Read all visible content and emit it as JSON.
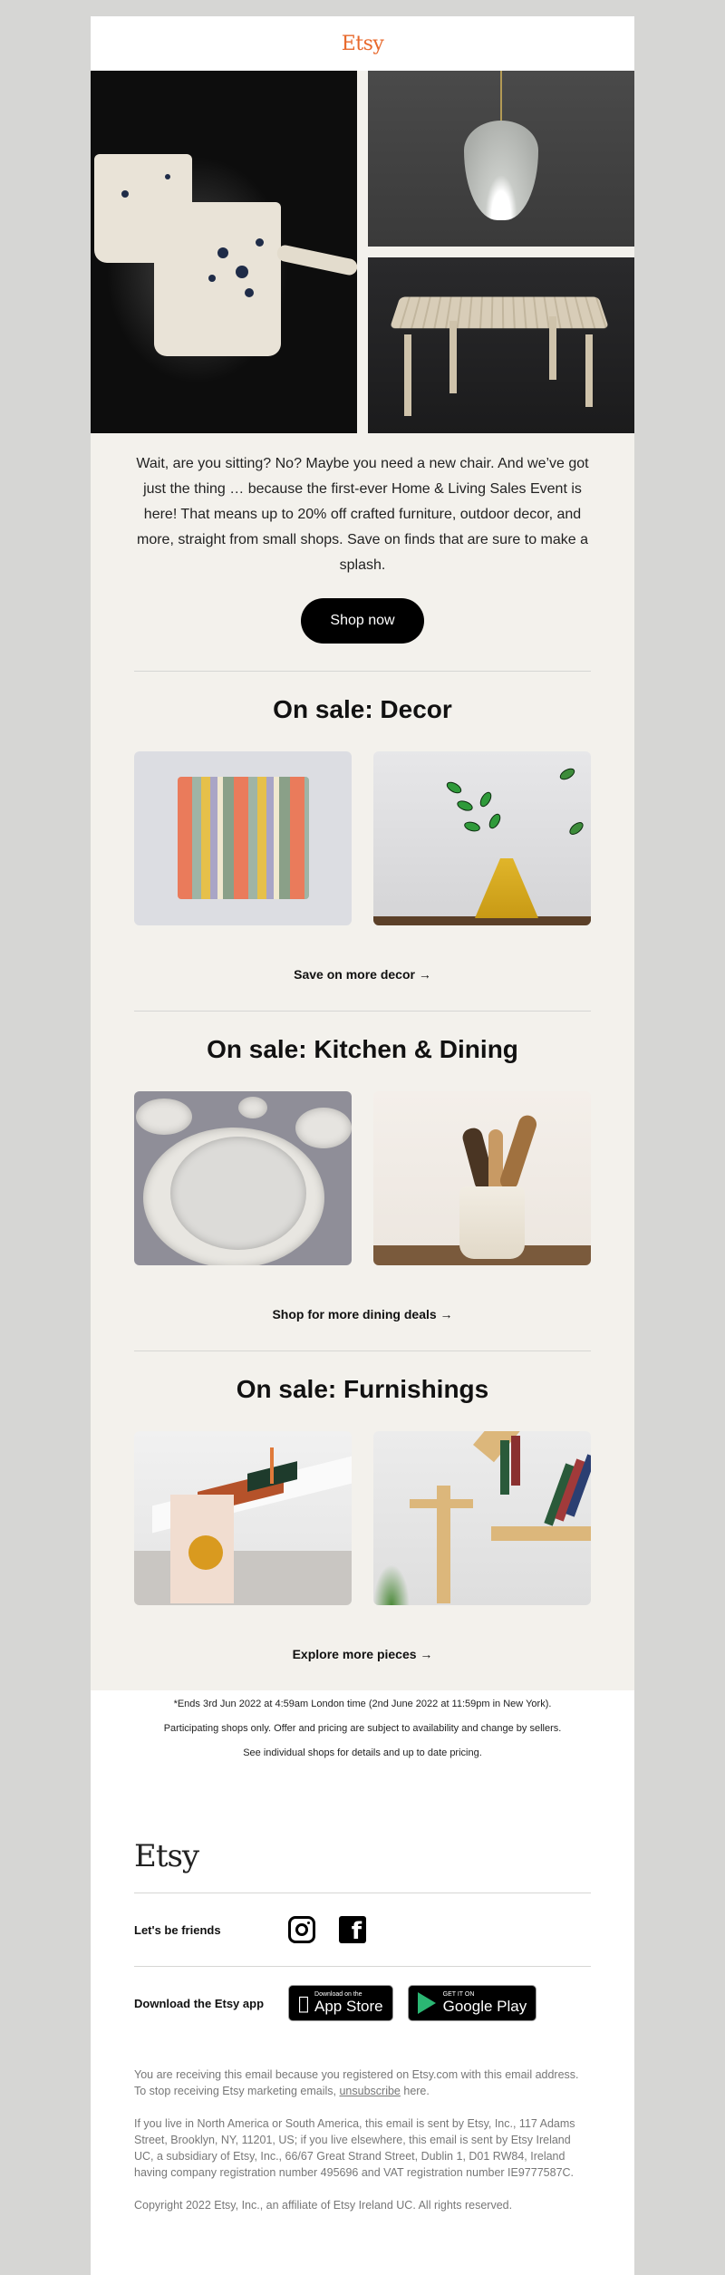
{
  "header": {
    "logo": "Etsy",
    "logo_color": "#e8692c"
  },
  "hero": {
    "images": [
      {
        "name": "speckled-ceramic-mugs"
      },
      {
        "name": "pendant-lamp"
      },
      {
        "name": "wooden-bench"
      }
    ]
  },
  "intro": {
    "text": "Wait, are you sitting? No? Maybe you need a new chair. And we’ve got just the thing … because the first-ever Home & Living Sales Event is here! That means up to 20% off crafted furniture, outdoor decor, and more, straight from small shops. Save on finds that are sure to make a splash.",
    "cta_label": "Shop now"
  },
  "sections": [
    {
      "title": "On sale: Decor",
      "images": [
        "striped woven pillow",
        "stained glass leaf in yellow vase"
      ],
      "link": "Save on more decor →"
    },
    {
      "title": "On sale: Kitchen & Dining",
      "images": [
        "ruffled ceramic plates",
        "wooden utensils in ceramic crock"
      ],
      "link": "Shop for more dining deals →"
    },
    {
      "title": "On sale: Furnishings",
      "images": [
        "quilted table runner",
        "wooden wall bookshelf"
      ],
      "link": "Explore more pieces →"
    }
  ],
  "fine_print": [
    "*Ends 3rd Jun 2022 at 4:59am London time (2nd June 2022 at 11:59pm in New York).",
    "Participating shops only. Offer and pricing are subject to availability and change by sellers.",
    "See individual shops for details and up to date pricing."
  ],
  "footer": {
    "logo": "Etsy",
    "social_label": "Let's be friends",
    "social_icons": [
      "instagram-icon",
      "facebook-icon"
    ],
    "app_label": "Download the Etsy app",
    "app_store": {
      "small": "Download on the",
      "big": "App Store"
    },
    "google_play": {
      "small": "GET IT ON",
      "big": "Google Play"
    },
    "legal_1_before": "You are receiving this email because you registered on Etsy.com with this email address. To stop receiving Etsy marketing emails, ",
    "legal_1_link": "unsubscribe",
    "legal_1_after": " here.",
    "legal_2": "If you live in North America or South America, this email is sent by Etsy, Inc., 117 Adams Street, Brooklyn, NY, 11201, US; if you live elsewhere, this email is sent by Etsy Ireland UC, a subsidiary of Etsy, Inc., 66/67 Great Strand Street, Dublin 1, D01 RW84, Ireland having company registration number 495696 and VAT registration number IE9777587C.",
    "copyright": "Copyright 2022 Etsy, Inc., an affiliate of Etsy Ireland UC. All rights reserved."
  }
}
